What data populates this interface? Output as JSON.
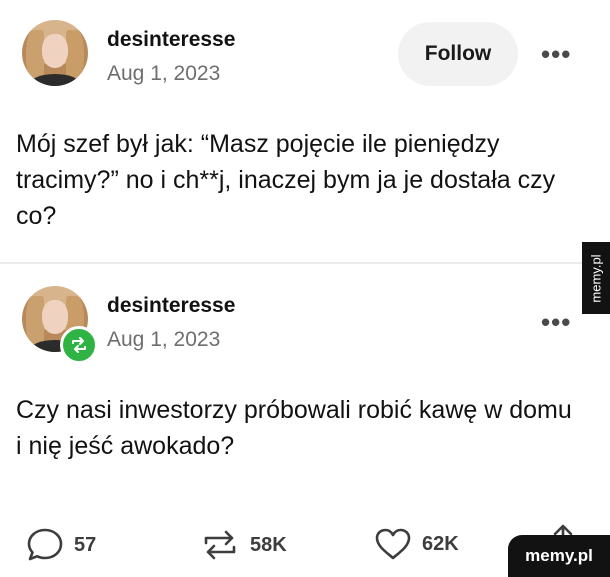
{
  "posts": [
    {
      "username": "desinteresse",
      "date": "Aug 1, 2023",
      "follow_label": "Follow",
      "more_label": "•••",
      "text": "Mój szef był jak: “Masz pojęcie ile pieniędzy tracimy?” no i ch**j, inaczej bym ja je dostała czy co?"
    },
    {
      "username": "desinteresse",
      "date": "Aug 1, 2023",
      "more_label": "•••",
      "text": "Czy nasi inwestorzy próbowali robić kawę w domu i nię jeść awokado?"
    }
  ],
  "actions": {
    "comments": "57",
    "reposts": "58K",
    "likes": "62K"
  },
  "watermark": "memy.pl",
  "colors": {
    "repost_badge": "#2fb344",
    "follow_bg": "#f2f2f2",
    "muted_text": "#6e6e6e"
  }
}
